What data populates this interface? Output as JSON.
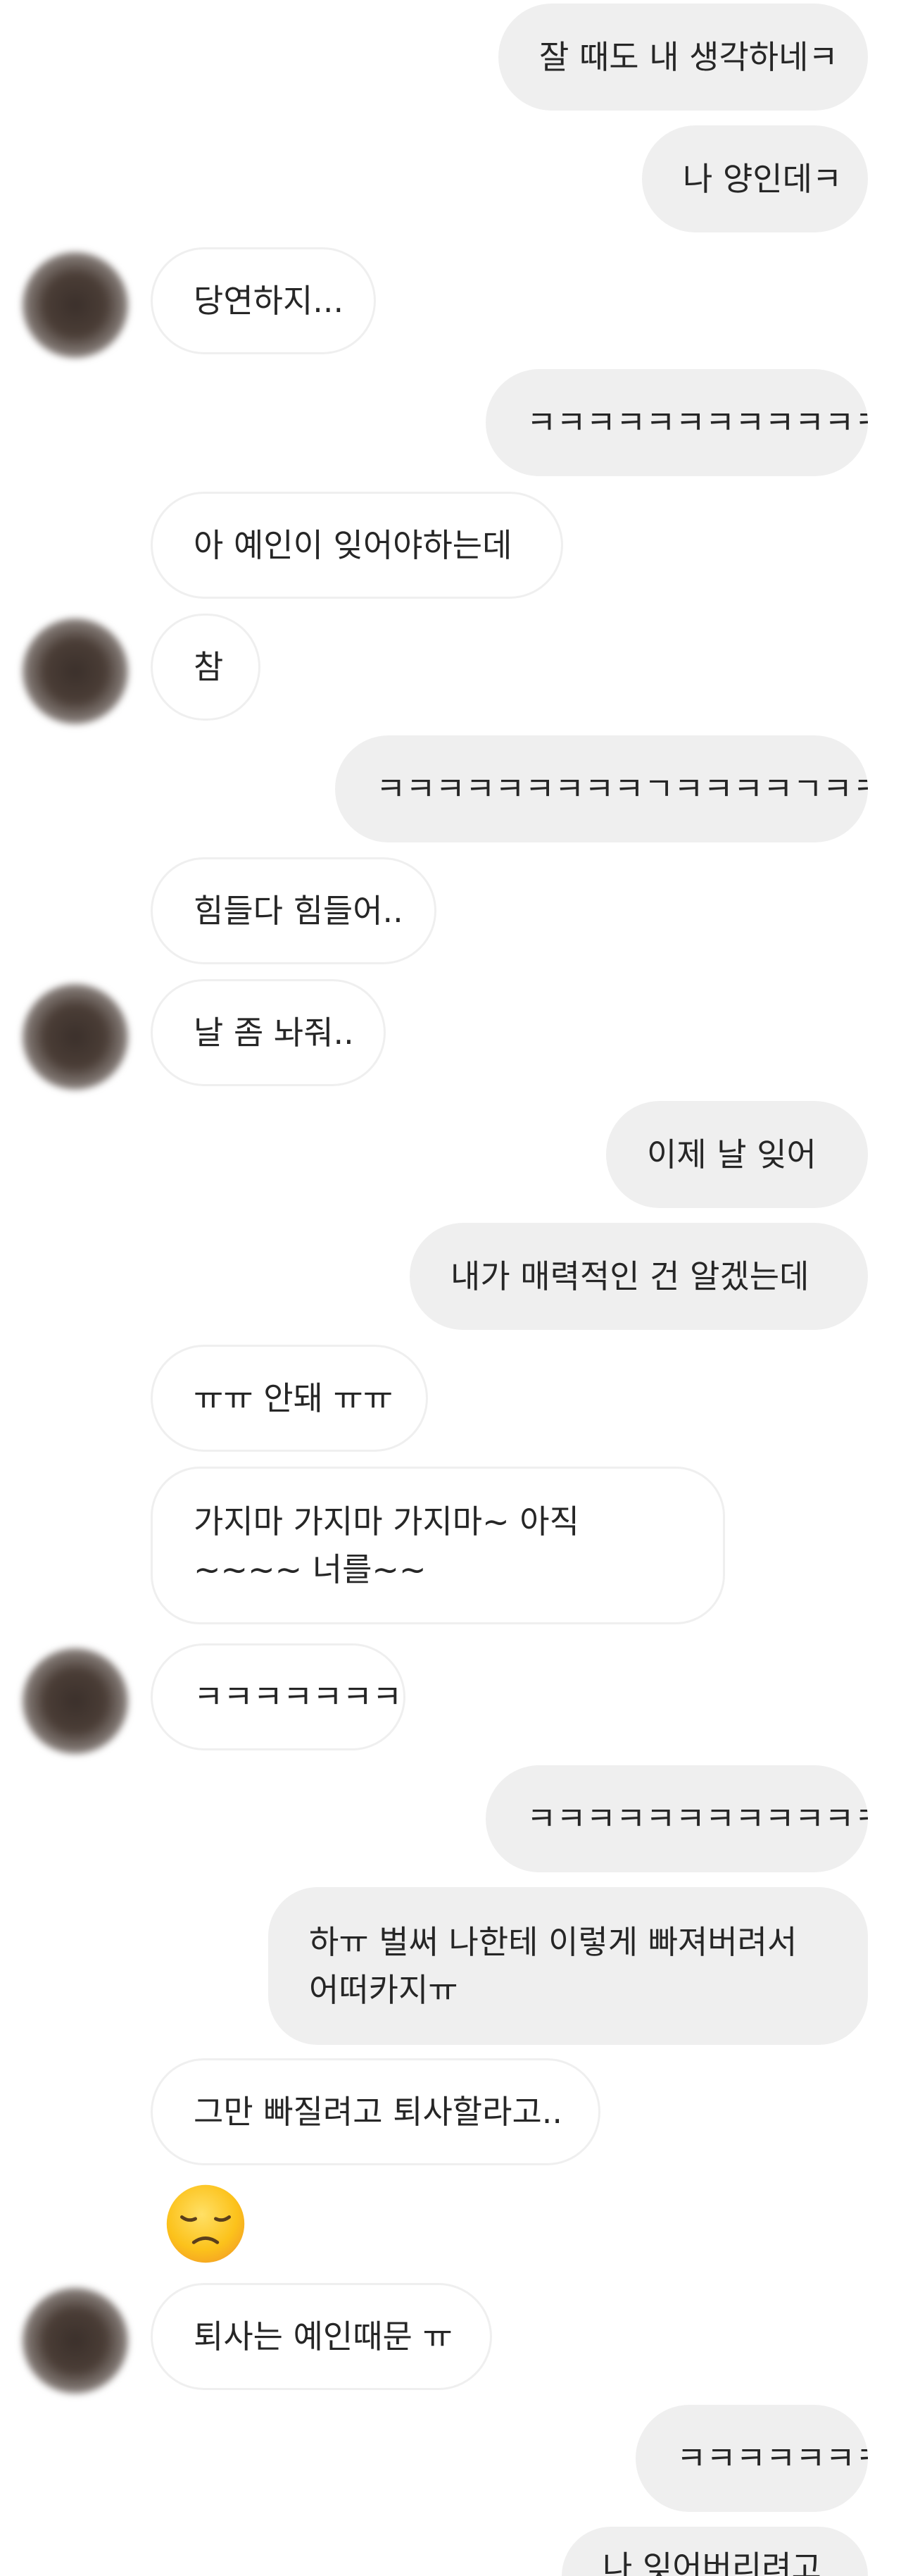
{
  "messages": [
    {
      "side": "me",
      "text": "잘 때도 내 생각하네ㅋ"
    },
    {
      "side": "me",
      "text": "나 양인데ㅋ"
    },
    {
      "side": "them",
      "text": "당연하지..."
    },
    {
      "side": "me",
      "text": "ㅋㅋㅋㅋㅋㅋㅋㅋㅋㅋㅋㅋㅋ"
    },
    {
      "side": "them",
      "text": "아 예인이 잊어야하는데"
    },
    {
      "side": "them",
      "text": "참"
    },
    {
      "side": "me",
      "text": "ㅋㅋㅋㅋㅋㅋㅋㅋㅋㄱㅋㅋㅋㅋㄱㅋㅋㅋㅋㅋㄱ"
    },
    {
      "side": "them",
      "text": "힘들다 힘들어.."
    },
    {
      "side": "them",
      "text": "날 좀 놔줘.."
    },
    {
      "side": "me",
      "text": "이제 날 잊어"
    },
    {
      "side": "me",
      "text": "내가 매력적인 건 알겠는데"
    },
    {
      "side": "them",
      "text": "ㅠㅠ 안돼 ㅠㅠ"
    },
    {
      "side": "them",
      "text": "가지마 가지마 가지마~ 아직~~~~ 너를~~"
    },
    {
      "side": "them",
      "text": "ㅋㅋㅋㅋㅋㅋㅋㅋ"
    },
    {
      "side": "me",
      "text": "ㅋㅋㅋㅋㅋㅋㅋㅋㅋㅋㅋㅋㅋ"
    },
    {
      "side": "me",
      "text": "하ㅠ 벌써 나한테 이렇게 빠져버려서 어떠카지ㅠ"
    },
    {
      "side": "them",
      "text": "그만 빠질려고 퇴사할라고.."
    },
    {
      "side": "them",
      "text": "퇴사는 예인때문 ㅠ"
    },
    {
      "side": "me",
      "text": "ㅋㅋㅋㅋㅋㅋㅋ"
    },
    {
      "side": "me",
      "text": "나 잊어버리려고"
    }
  ],
  "emoji": {
    "name": "disappointed-face-emoji",
    "symbol": "😞"
  },
  "colors": {
    "my_bubble": "#efefef",
    "their_bubble_border": "#efefef",
    "text": "#262626",
    "background": "#ffffff"
  }
}
